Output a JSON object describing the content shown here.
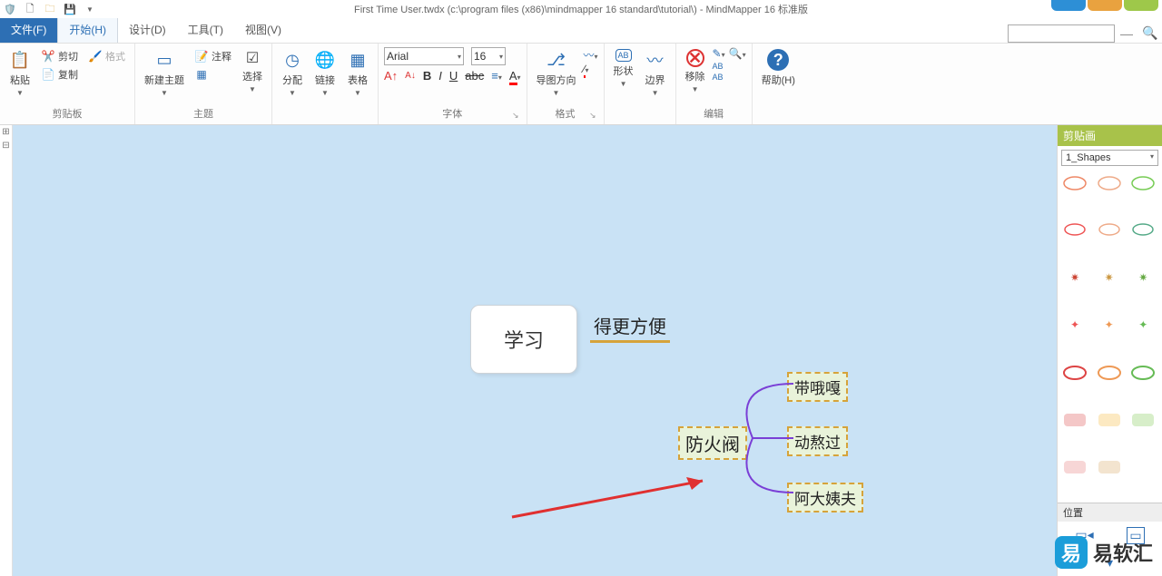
{
  "app": {
    "title": "First Time User.twdx (c:\\program files (x86)\\mindmapper 16 standard\\tutorial\\) - MindMapper 16 标准版"
  },
  "qat_icons": [
    "app-shield",
    "new-doc",
    "open-folder",
    "save-disk",
    "dropdown"
  ],
  "tabs": {
    "file": "文件(F)",
    "items": [
      "开始(H)",
      "设计(D)",
      "工具(T)",
      "视图(V)"
    ],
    "active_index": 0
  },
  "ribbon": {
    "clipboard": {
      "paste": "粘贴",
      "cut": "剪切",
      "copy": "复制",
      "format": "格式",
      "label": "剪贴板"
    },
    "topic": {
      "new_topic": "新建主题",
      "note": "注释",
      "select": "选择",
      "label": "主题"
    },
    "distribute": "分配",
    "link": "链接",
    "table": "表格",
    "font": {
      "family": "Arial",
      "size": "16",
      "label": "字体"
    },
    "direction": "导图方向",
    "format_group": {
      "shape": "形状",
      "boundary": "边界",
      "label": "格式"
    },
    "edit": {
      "remove": "移除",
      "label": "编辑"
    },
    "help": "帮助(H)"
  },
  "canvas_nodes": {
    "root": "学习",
    "branch1": "得更方便",
    "branch2": "防火阀",
    "sub1": "带哦嘎",
    "sub2": "动熬过",
    "sub3": "阿大姨夫"
  },
  "sidepanel": {
    "clipart_title": "剪贴画",
    "shapes_combo": "1_Shapes",
    "position_title": "位置"
  },
  "watermark": "易软汇"
}
